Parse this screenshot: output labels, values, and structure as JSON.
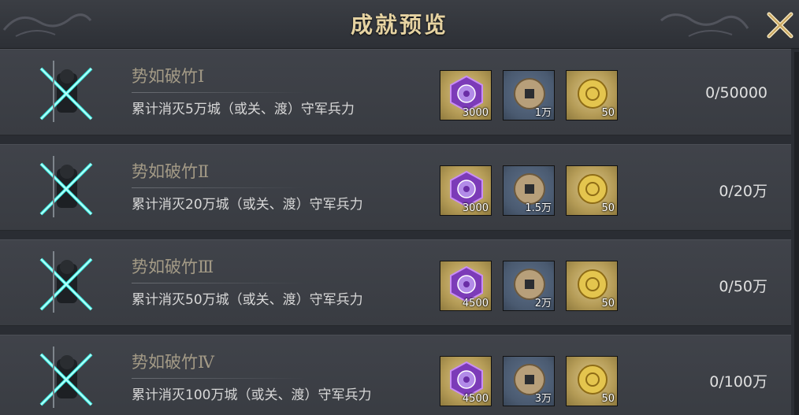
{
  "header": {
    "title": "成就预览"
  },
  "achievements": [
    {
      "name": "势如破竹Ⅰ",
      "desc": "累计消灭5万城（或关、渡）守军兵力",
      "progress": "0/50000",
      "rewards": [
        "3000",
        "1万",
        "50"
      ]
    },
    {
      "name": "势如破竹Ⅱ",
      "desc": "累计消灭20万城（或关、渡）守军兵力",
      "progress": "0/20万",
      "rewards": [
        "3000",
        "1.5万",
        "50"
      ]
    },
    {
      "name": "势如破竹Ⅲ",
      "desc": "累计消灭50万城（或关、渡）守军兵力",
      "progress": "0/50万",
      "rewards": [
        "4500",
        "2万",
        "50"
      ]
    },
    {
      "name": "势如破竹Ⅳ",
      "desc": "累计消灭100万城（或关、渡）守军兵力",
      "progress": "0/100万",
      "rewards": [
        "4500",
        "3万",
        "50"
      ]
    }
  ],
  "icons": {
    "emblem": "crossed-swords-warrior-icon",
    "reward_1": "purple-token-icon",
    "reward_2": "copper-coin-icon",
    "reward_3": "gold-coin-icon",
    "close": "close-icon"
  },
  "colors": {
    "title": "#e6d3a2",
    "emblem_glow": "#3ff2e8",
    "name": "#a39a86"
  }
}
